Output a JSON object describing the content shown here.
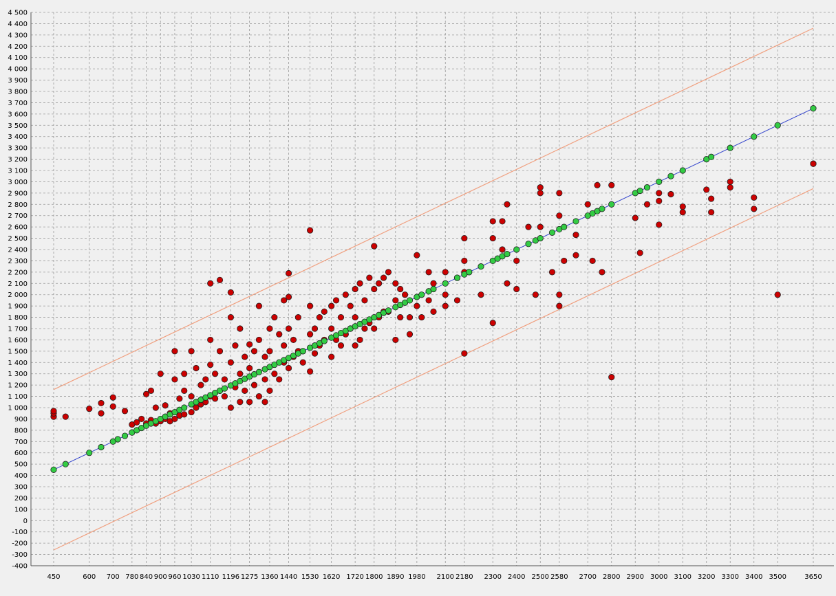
{
  "chart_data": {
    "type": "scatter",
    "title": "",
    "xlabel": "",
    "ylabel": "",
    "x_ticks": [
      450,
      600,
      700,
      780,
      840,
      900,
      960,
      1030,
      1110,
      1196,
      1275,
      1360,
      1440,
      1530,
      1620,
      1720,
      1800,
      1890,
      1980,
      2100,
      2180,
      2300,
      2400,
      2500,
      2580,
      2700,
      2800,
      2900,
      3000,
      3100,
      3200,
      3300,
      3400,
      3500,
      3650
    ],
    "x_tick_labels": [
      "450",
      "600",
      "700",
      "780",
      "840",
      "900",
      "960",
      "1030",
      "1110",
      "1196",
      "1275",
      "1360",
      "1440",
      "1530",
      "1620",
      "1720",
      "1800",
      "1890",
      "1980",
      "2100",
      "2180",
      "2300",
      "2400",
      "2500",
      "2580",
      "2700",
      "2800",
      "2900",
      "3000",
      "3100",
      "3200",
      "3300",
      "3400",
      "3500",
      "3650"
    ],
    "ylim": [
      -400,
      4500
    ],
    "y_tick_step": 100,
    "y_tick_labels": [
      "4 500",
      "4 400",
      "4 300",
      "4 200",
      "4 100",
      "4 000",
      "3 900",
      "3 800",
      "3 700",
      "3 600",
      "3 500",
      "3 400",
      "3 300",
      "3 200",
      "3 100",
      "3 000",
      "2 900",
      "2 800",
      "2 700",
      "2 600",
      "2 500",
      "2 400",
      "2 300",
      "2 200",
      "2 100",
      "2 000",
      "1 900",
      "1 800",
      "1 700",
      "1 600",
      "1 500",
      "1 400",
      "1 300",
      "1 200",
      "1 100",
      "1 000",
      "900",
      "800",
      "700",
      "600",
      "500",
      "400",
      "300",
      "200",
      "100",
      "0",
      "-100",
      "-200",
      "-300",
      "-400"
    ],
    "grid": true,
    "colors": {
      "observed": "#cc0000",
      "predicted": "#33cc44",
      "fit_line": "#3344cc",
      "band_line": "#f0a080",
      "grid": "#999999",
      "background": "#f0f0f0"
    },
    "fit_line": {
      "x": [
        450,
        3650
      ],
      "y": [
        450,
        3650
      ]
    },
    "upper_band": {
      "x": [
        450,
        3650
      ],
      "y": [
        1160,
        4360
      ]
    },
    "lower_band": {
      "x": [
        450,
        3650
      ],
      "y": [
        -260,
        2940
      ]
    },
    "series": [
      {
        "marker": "circle",
        "role": "predicted",
        "x": [
          450,
          500,
          600,
          650,
          700,
          720,
          750,
          780,
          800,
          820,
          840,
          860,
          880,
          900,
          920,
          940,
          960,
          980,
          1000,
          1030,
          1050,
          1070,
          1090,
          1110,
          1130,
          1150,
          1170,
          1196,
          1215,
          1235,
          1255,
          1275,
          1295,
          1315,
          1340,
          1360,
          1380,
          1400,
          1420,
          1440,
          1460,
          1480,
          1500,
          1530,
          1550,
          1570,
          1590,
          1620,
          1640,
          1660,
          1680,
          1700,
          1720,
          1740,
          1760,
          1780,
          1800,
          1820,
          1840,
          1860,
          1890,
          1910,
          1930,
          1950,
          1980,
          2000,
          2030,
          2050,
          2100,
          2150,
          2180,
          2200,
          2250,
          2300,
          2320,
          2340,
          2360,
          2400,
          2450,
          2480,
          2500,
          2550,
          2580,
          2600,
          2650,
          2700,
          2720,
          2740,
          2760,
          2800,
          2900,
          2920,
          2950,
          3000,
          3050,
          3100,
          3200,
          3220,
          3300,
          3400,
          3500,
          3650
        ],
        "y": [
          450,
          500,
          600,
          650,
          700,
          720,
          750,
          780,
          800,
          820,
          840,
          860,
          880,
          900,
          920,
          940,
          960,
          980,
          1000,
          1030,
          1050,
          1070,
          1090,
          1110,
          1130,
          1150,
          1170,
          1196,
          1215,
          1235,
          1255,
          1275,
          1295,
          1315,
          1340,
          1360,
          1380,
          1400,
          1420,
          1440,
          1460,
          1480,
          1500,
          1530,
          1550,
          1570,
          1590,
          1620,
          1640,
          1660,
          1680,
          1700,
          1720,
          1740,
          1760,
          1780,
          1800,
          1820,
          1840,
          1860,
          1890,
          1910,
          1930,
          1950,
          1980,
          2000,
          2030,
          2050,
          2100,
          2150,
          2180,
          2200,
          2250,
          2300,
          2320,
          2340,
          2360,
          2400,
          2450,
          2480,
          2500,
          2550,
          2580,
          2600,
          2650,
          2700,
          2720,
          2740,
          2760,
          2800,
          2900,
          2920,
          2950,
          3000,
          3050,
          3100,
          3200,
          3220,
          3300,
          3400,
          3500,
          3650
        ]
      },
      {
        "marker": "circle",
        "role": "observed",
        "x": [
          450,
          450,
          450,
          500,
          600,
          650,
          650,
          700,
          700,
          750,
          780,
          800,
          820,
          840,
          840,
          860,
          860,
          880,
          880,
          900,
          900,
          920,
          920,
          940,
          940,
          960,
          960,
          960,
          980,
          980,
          1000,
          1000,
          1000,
          1030,
          1030,
          1030,
          1050,
          1050,
          1070,
          1070,
          1090,
          1090,
          1110,
          1110,
          1110,
          1110,
          1130,
          1130,
          1150,
          1150,
          1150,
          1170,
          1170,
          1196,
          1196,
          1196,
          1196,
          1215,
          1215,
          1235,
          1235,
          1235,
          1255,
          1255,
          1275,
          1275,
          1275,
          1295,
          1295,
          1315,
          1315,
          1315,
          1340,
          1340,
          1340,
          1360,
          1360,
          1360,
          1380,
          1380,
          1400,
          1400,
          1420,
          1420,
          1420,
          1440,
          1440,
          1440,
          1440,
          1460,
          1460,
          1480,
          1480,
          1500,
          1500,
          1530,
          1530,
          1530,
          1530,
          1550,
          1550,
          1570,
          1570,
          1590,
          1590,
          1620,
          1620,
          1620,
          1640,
          1640,
          1660,
          1660,
          1680,
          1680,
          1700,
          1700,
          1720,
          1720,
          1720,
          1740,
          1740,
          1760,
          1760,
          1780,
          1780,
          1800,
          1800,
          1800,
          1820,
          1820,
          1840,
          1840,
          1860,
          1860,
          1890,
          1890,
          1890,
          1910,
          1910,
          1930,
          1950,
          1950,
          1980,
          1980,
          2000,
          2030,
          2030,
          2050,
          2050,
          2100,
          2100,
          2100,
          2150,
          2150,
          2180,
          2180,
          2180,
          2180,
          2200,
          2250,
          2300,
          2300,
          2300,
          2340,
          2340,
          2360,
          2360,
          2400,
          2400,
          2450,
          2480,
          2500,
          2500,
          2500,
          2550,
          2580,
          2580,
          2580,
          2580,
          2600,
          2650,
          2650,
          2700,
          2720,
          2740,
          2760,
          2800,
          2800,
          2900,
          2920,
          2950,
          3000,
          3000,
          3000,
          3050,
          3100,
          3100,
          3200,
          3220,
          3220,
          3300,
          3300,
          3400,
          3400,
          3500,
          3650,
          3650
        ],
        "y": [
          920,
          950,
          970,
          920,
          990,
          1040,
          950,
          1010,
          1090,
          970,
          850,
          870,
          900,
          1120,
          860,
          1150,
          890,
          1000,
          860,
          1300,
          880,
          1020,
          900,
          950,
          880,
          1500,
          1250,
          900,
          1080,
          930,
          1300,
          1150,
          940,
          1500,
          1100,
          960,
          1350,
          1000,
          1200,
          1030,
          1250,
          1050,
          2100,
          1600,
          1380,
          1100,
          1300,
          1080,
          2130,
          1500,
          1150,
          1250,
          1100,
          2020,
          1800,
          1400,
          1000,
          1550,
          1180,
          1700,
          1300,
          1050,
          1450,
          1150,
          1560,
          1350,
          1050,
          1500,
          1200,
          1900,
          1600,
          1100,
          1450,
          1250,
          1050,
          1700,
          1500,
          1150,
          1800,
          1300,
          1650,
          1250,
          1950,
          1550,
          1400,
          2190,
          1980,
          1700,
          1350,
          1600,
          1450,
          1800,
          1500,
          1500,
          1400,
          2570,
          1900,
          1650,
          1320,
          1700,
          1480,
          1800,
          1550,
          1850,
          1600,
          1900,
          1700,
          1450,
          1950,
          1600,
          1800,
          1550,
          2000,
          1650,
          1900,
          1700,
          2050,
          1800,
          1550,
          2100,
          1600,
          1950,
          1700,
          2150,
          1750,
          2430,
          2050,
          1700,
          2100,
          1800,
          2150,
          1850,
          2200,
          1850,
          2100,
          1950,
          1600,
          2050,
          1800,
          2000,
          1800,
          1650,
          2350,
          1900,
          1800,
          2200,
          1950,
          2100,
          1850,
          2200,
          2000,
          1900,
          2150,
          1950,
          2500,
          2200,
          1480,
          2300,
          2200,
          2000,
          1750,
          2650,
          2500,
          2400,
          2650,
          2800,
          2100,
          2050,
          2300,
          2600,
          2000,
          2950,
          2900,
          2600,
          2200,
          1900,
          2700,
          2900,
          2000,
          2300,
          2350,
          2530,
          2800,
          2300,
          2970,
          2200,
          1270,
          2970,
          2680,
          2370,
          2800,
          2900,
          2830,
          2620,
          2890,
          2780,
          2730,
          2930,
          2850,
          2730,
          3000,
          2950,
          2860,
          2760,
          2000,
          3160,
          3160
        ]
      }
    ]
  }
}
